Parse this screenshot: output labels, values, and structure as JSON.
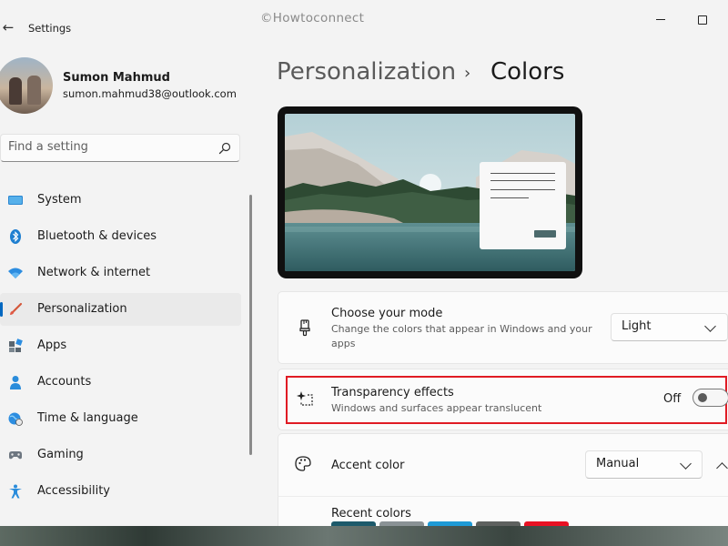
{
  "window": {
    "app_title": "Settings",
    "watermark": "©Howtoconnect"
  },
  "profile": {
    "name": "Sumon Mahmud",
    "email": "sumon.mahmud38@outlook.com"
  },
  "search": {
    "placeholder": "Find a setting"
  },
  "nav": {
    "items": [
      {
        "label": "System",
        "icon": "monitor-icon"
      },
      {
        "label": "Bluetooth & devices",
        "icon": "bluetooth-icon"
      },
      {
        "label": "Network & internet",
        "icon": "wifi-icon"
      },
      {
        "label": "Personalization",
        "icon": "paintbrush-icon",
        "active": true
      },
      {
        "label": "Apps",
        "icon": "apps-icon"
      },
      {
        "label": "Accounts",
        "icon": "person-icon"
      },
      {
        "label": "Time & language",
        "icon": "globe-clock-icon"
      },
      {
        "label": "Gaming",
        "icon": "gamepad-icon"
      },
      {
        "label": "Accessibility",
        "icon": "accessibility-icon"
      }
    ]
  },
  "breadcrumb": {
    "parent": "Personalization",
    "separator": "›",
    "current": "Colors"
  },
  "mode": {
    "title": "Choose your mode",
    "description": "Change the colors that appear in Windows and your apps",
    "value": "Light"
  },
  "transparency": {
    "title": "Transparency effects",
    "description": "Windows and surfaces appear translucent",
    "state_label": "Off",
    "enabled": false
  },
  "accent": {
    "title": "Accent color",
    "value": "Manual"
  },
  "recent_colors": {
    "title": "Recent colors",
    "swatches": [
      "#1d5a6b",
      "#8a9295",
      "#1e9ad6",
      "#5e615f",
      "#e81123"
    ]
  },
  "colors": {
    "accent_blue": "#0067c0",
    "highlight_red": "#e01b24"
  }
}
